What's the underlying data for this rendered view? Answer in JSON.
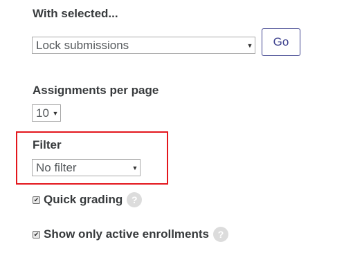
{
  "with_selected": {
    "heading": "With selected...",
    "action_select_value": "Lock submissions",
    "go_label": "Go"
  },
  "per_page": {
    "heading": "Assignments per page",
    "select_value": "10"
  },
  "filter": {
    "heading": "Filter",
    "select_value": "No filter"
  },
  "options": [
    {
      "label": "Quick grading",
      "checked": true,
      "help_icon": "question-mark"
    },
    {
      "label": "Show only active enrollments",
      "checked": true,
      "help_icon": "question-mark"
    }
  ],
  "glyphs": {
    "dropdown_arrow": "▼",
    "check_mark": "✔",
    "help": "?"
  },
  "colors": {
    "go_button": "#3a3e8c",
    "highlight": "#e3161c",
    "help_icon_bg": "#dcdcdc"
  }
}
